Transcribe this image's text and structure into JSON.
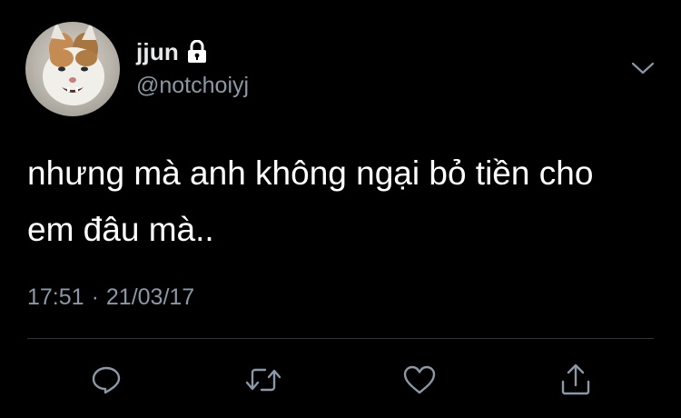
{
  "tweet": {
    "display_name": "jjun",
    "handle": "@notchoiyj",
    "protected_icon": "lock-icon",
    "text_line1": "nhưng mà anh không ngại bỏ tiền cho",
    "text_line2": "em đâu mà..",
    "time": "17:51",
    "separator": "·",
    "date": "21/03/17"
  },
  "actions": {
    "reply_icon": "reply-icon",
    "retweet_icon": "retweet-icon",
    "like_icon": "heart-icon",
    "share_icon": "share-icon"
  },
  "colors": {
    "background": "#000000",
    "primary_text": "#ffffff",
    "secondary_text": "#8b98a5",
    "divider": "#2f3336"
  }
}
